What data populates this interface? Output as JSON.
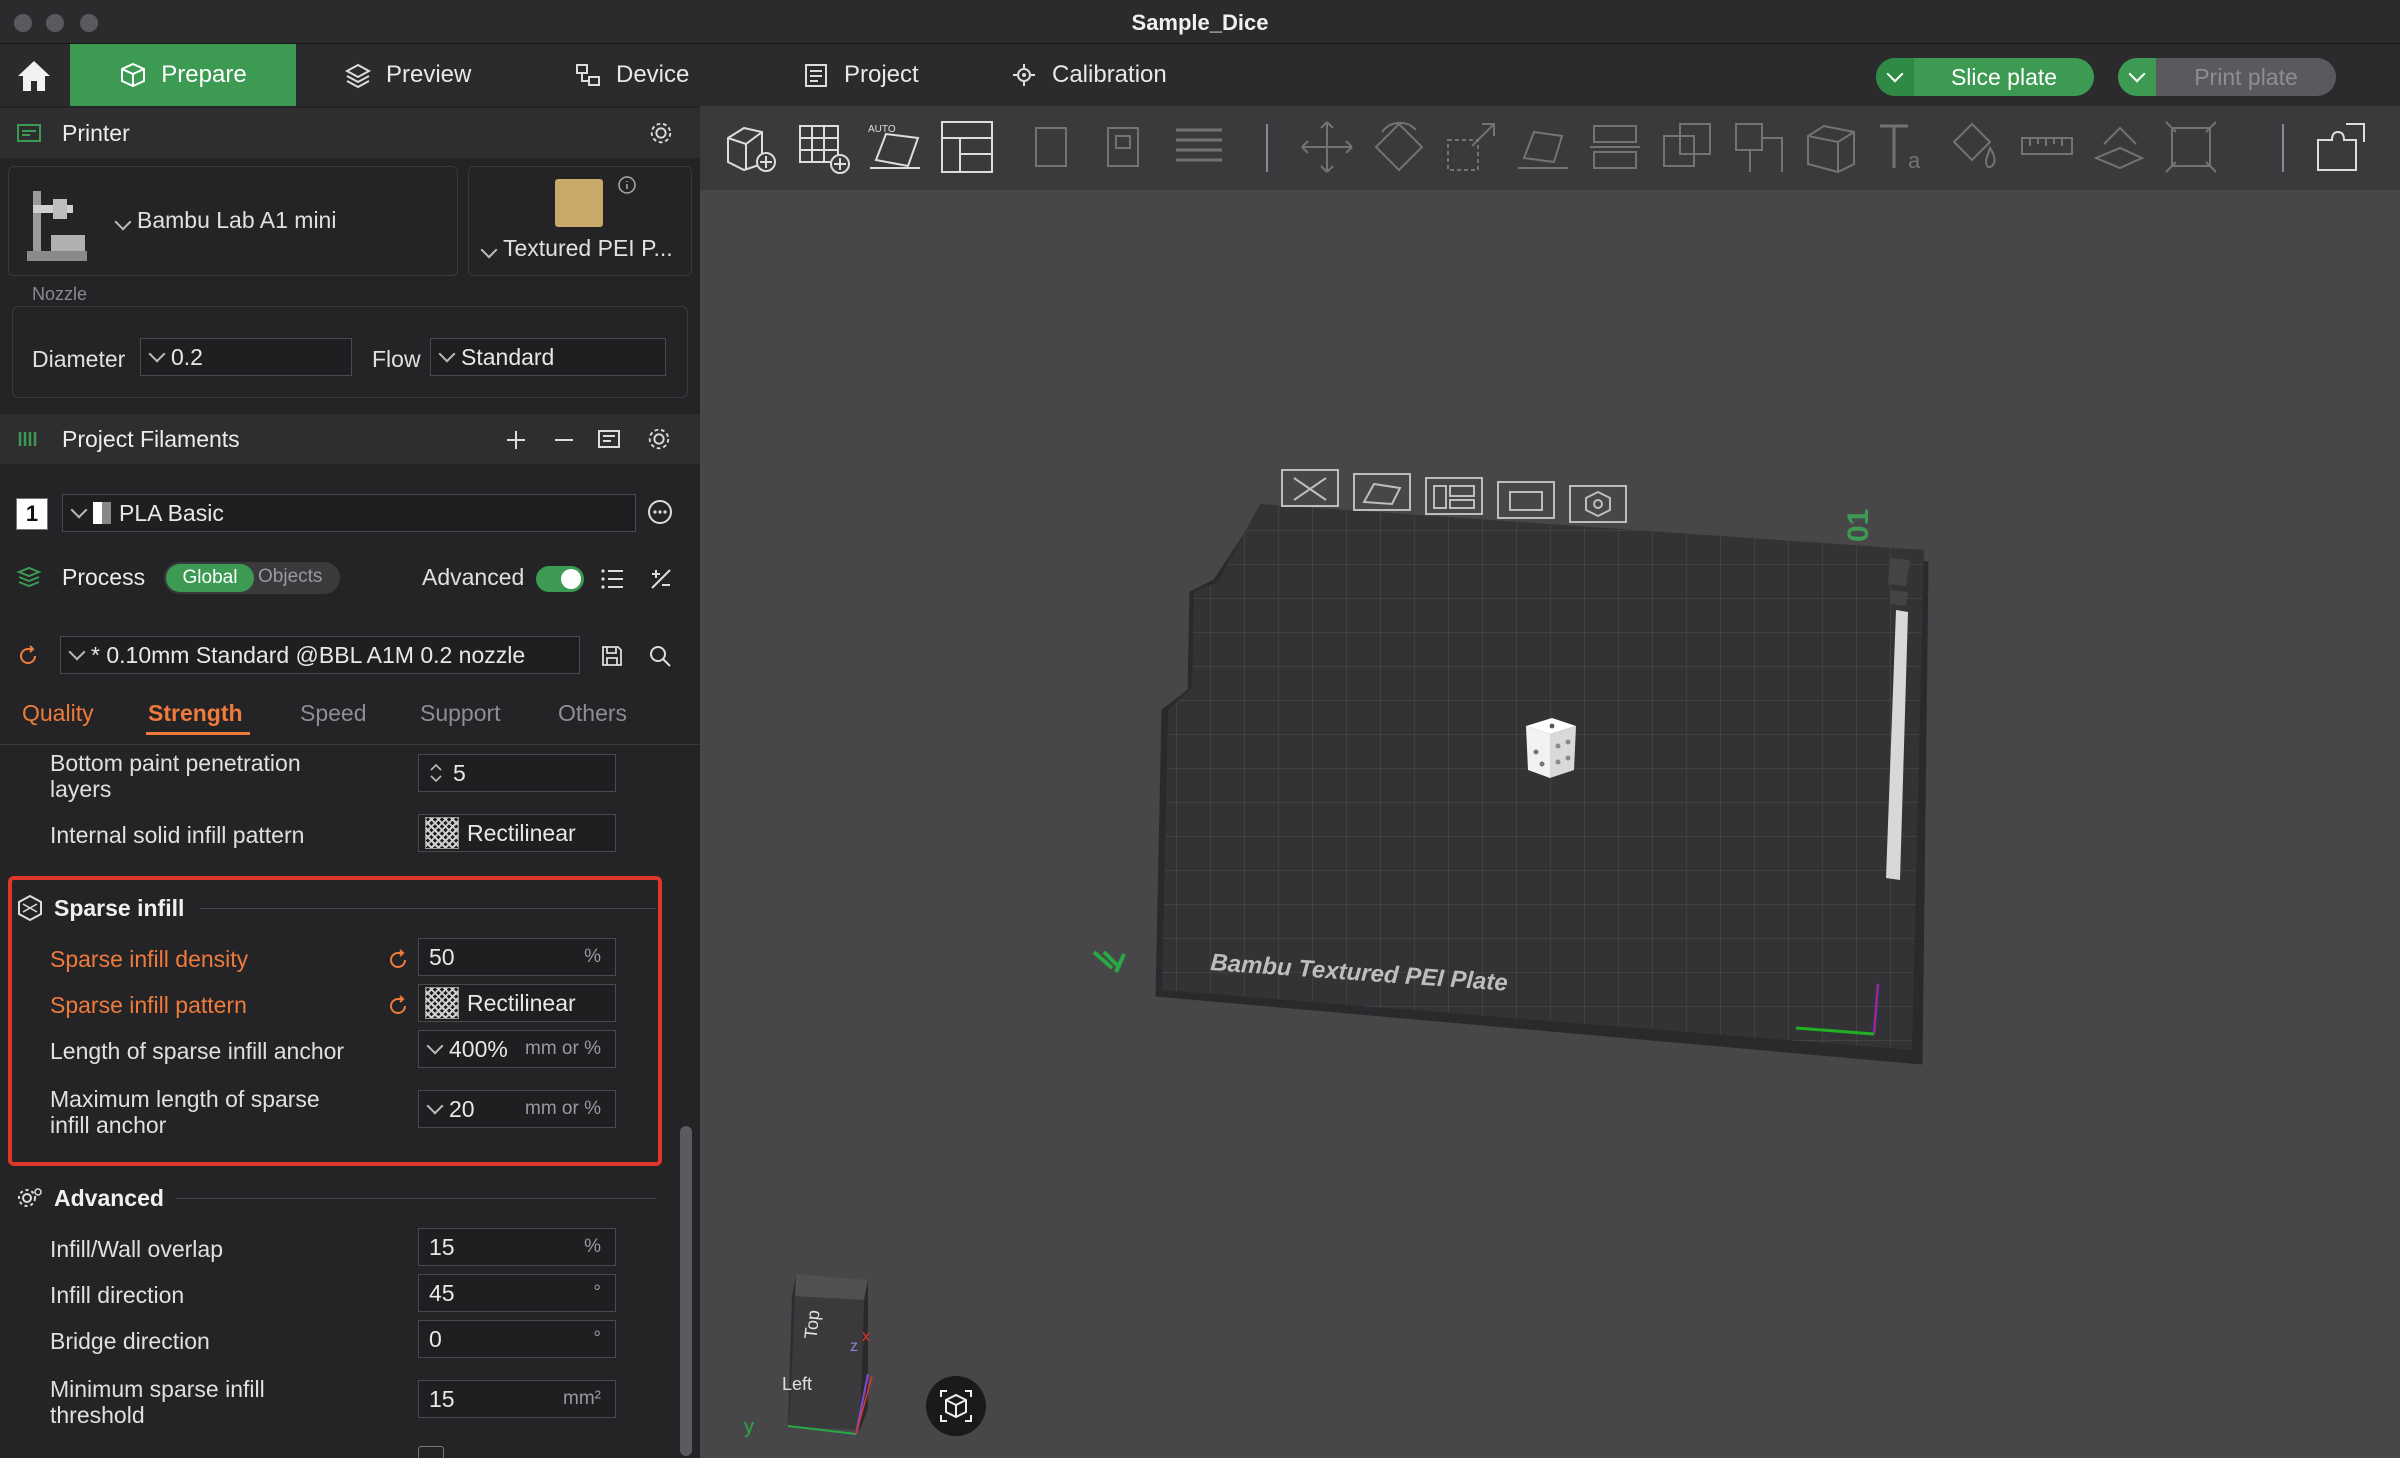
{
  "window": {
    "title": "Sample_Dice"
  },
  "menu": {
    "tabs": [
      {
        "label": "Prepare",
        "active": true
      },
      {
        "label": "Preview"
      },
      {
        "label": "Device"
      },
      {
        "label": "Project"
      },
      {
        "label": "Calibration"
      }
    ],
    "slice_label": "Slice plate",
    "print_label": "Print plate"
  },
  "printer": {
    "header": "Printer",
    "name": "Bambu Lab A1 mini",
    "plate": "Textured PEI P...",
    "nozzle_label": "Nozzle",
    "diameter_label": "Diameter",
    "diameter_value": "0.2",
    "flow_label": "Flow",
    "flow_value": "Standard"
  },
  "filaments": {
    "header": "Project Filaments",
    "items": [
      {
        "index": "1",
        "name": "PLA Basic"
      }
    ]
  },
  "process": {
    "header": "Process",
    "scope_global": "Global",
    "scope_objects": "Objects",
    "advanced_label": "Advanced",
    "advanced_on": true,
    "preset": "* 0.10mm Standard @BBL A1M 0.2 nozzle",
    "tabs": [
      {
        "label": "Quality"
      },
      {
        "label": "Strength",
        "active": true
      },
      {
        "label": "Speed"
      },
      {
        "label": "Support"
      },
      {
        "label": "Others"
      }
    ]
  },
  "settings": {
    "bottom_paint_label_1": "Bottom paint penetration",
    "bottom_paint_label_2": "layers",
    "bottom_paint_value": "5",
    "internal_solid_label": "Internal solid infill pattern",
    "internal_solid_value": "Rectilinear",
    "sparse_group": "Sparse infill",
    "sparse_density_label": "Sparse infill density",
    "sparse_density_value": "50",
    "sparse_density_unit": "%",
    "sparse_pattern_label": "Sparse infill pattern",
    "sparse_pattern_value": "Rectilinear",
    "anchor_label": "Length of sparse infill anchor",
    "anchor_value": "400%",
    "anchor_unit": "mm or %",
    "max_anchor_label_1": "Maximum length of sparse",
    "max_anchor_label_2": "infill anchor",
    "max_anchor_value": "20",
    "max_anchor_unit": "mm or %",
    "advanced_group": "Advanced",
    "overlap_label": "Infill/Wall overlap",
    "overlap_value": "15",
    "overlap_unit": "%",
    "infill_dir_label": "Infill direction",
    "infill_dir_value": "45",
    "infill_dir_unit": "°",
    "bridge_dir_label": "Bridge direction",
    "bridge_dir_value": "0",
    "bridge_dir_unit": "°",
    "min_sparse_label_1": "Minimum sparse infill",
    "min_sparse_label_2": "threshold",
    "min_sparse_value": "15",
    "min_sparse_unit": "mm²"
  },
  "viewport": {
    "plate_label": "Bambu Textured PEI Plate",
    "plate_number": "01",
    "cube_top": "Top",
    "cube_left": "Left",
    "axis_x": "x",
    "axis_y": "y",
    "axis_z": "z"
  },
  "colors": {
    "accent_green": "#3d9a52",
    "accent_orange": "#ee7b3b",
    "highlight_red": "#e0352b"
  }
}
